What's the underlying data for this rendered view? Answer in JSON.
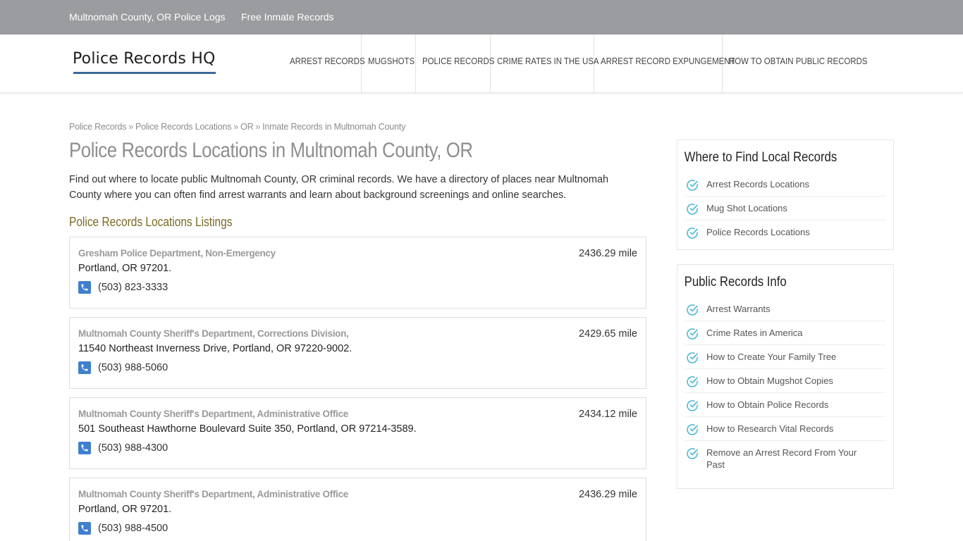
{
  "topbar": {
    "link1": "Multnomah County, OR Police Logs",
    "link2": "Free Inmate Records"
  },
  "logo": "Police Records HQ",
  "nav": [
    "ARREST RECORDS",
    "MUGSHOTS",
    "POLICE RECORDS",
    "CRIME RATES IN THE USA",
    "ARREST RECORD EXPUNGEMENT",
    "HOW TO OBTAIN PUBLIC RECORDS"
  ],
  "breadcrumb": {
    "items": [
      "Police Records",
      "Police Records Locations",
      "OR",
      "Inmate Records in Multnomah County"
    ],
    "separator": "»"
  },
  "page_title": "Police Records Locations in Multnomah County, OR",
  "intro": "Find out where to locate public Multnomah County, OR criminal records. We have a directory of places near Multnomah County where you can often find arrest warrants and learn about background screenings and online searches.",
  "listings_heading": "Police Records Locations Listings",
  "listings": [
    {
      "name": "Gresham Police Department, Non-Emergency",
      "distance": "2436.29 mile",
      "address": "Portland, OR 97201.",
      "phone": "(503) 823-3333"
    },
    {
      "name": "Multnomah County Sheriff's Department, Corrections Division,",
      "distance": "2429.65 mile",
      "address": "11540 Northeast Inverness Drive, Portland, OR 97220-9002.",
      "phone": "(503) 988-5060"
    },
    {
      "name": "Multnomah County Sheriff's Department, Administrative Office",
      "distance": "2434.12 mile",
      "address": "501 Southeast Hawthorne Boulevard Suite 350, Portland, OR 97214-3589.",
      "phone": "(503) 988-4300"
    },
    {
      "name": "Multnomah County Sheriff's Department, Administrative Office",
      "distance": "2436.29 mile",
      "address": "Portland, OR 97201.",
      "phone": "(503) 988-4500"
    }
  ],
  "sidebar": {
    "local": {
      "title": "Where to Find Local Records",
      "items": [
        "Arrest Records Locations",
        "Mug Shot Locations",
        "Police Records Locations"
      ]
    },
    "info": {
      "title": "Public Records Info",
      "items": [
        "Arrest Warrants",
        "Crime Rates in America",
        "How to Create Your Family Tree",
        "How to Obtain Mugshot Copies",
        "How to Obtain Police Records",
        "How to Research Vital Records",
        "Remove an Arrest Record From Your Past"
      ]
    }
  },
  "colors": {
    "topbar": "#9a9c9f",
    "logo_underline": "#3b6a9a",
    "listings_heading": "#7a6a24",
    "phone_icon": "#3f7fcf",
    "check_icon": "#4fb8d8"
  },
  "icons": {
    "phone": "phone-icon",
    "check": "check-circle-icon"
  }
}
